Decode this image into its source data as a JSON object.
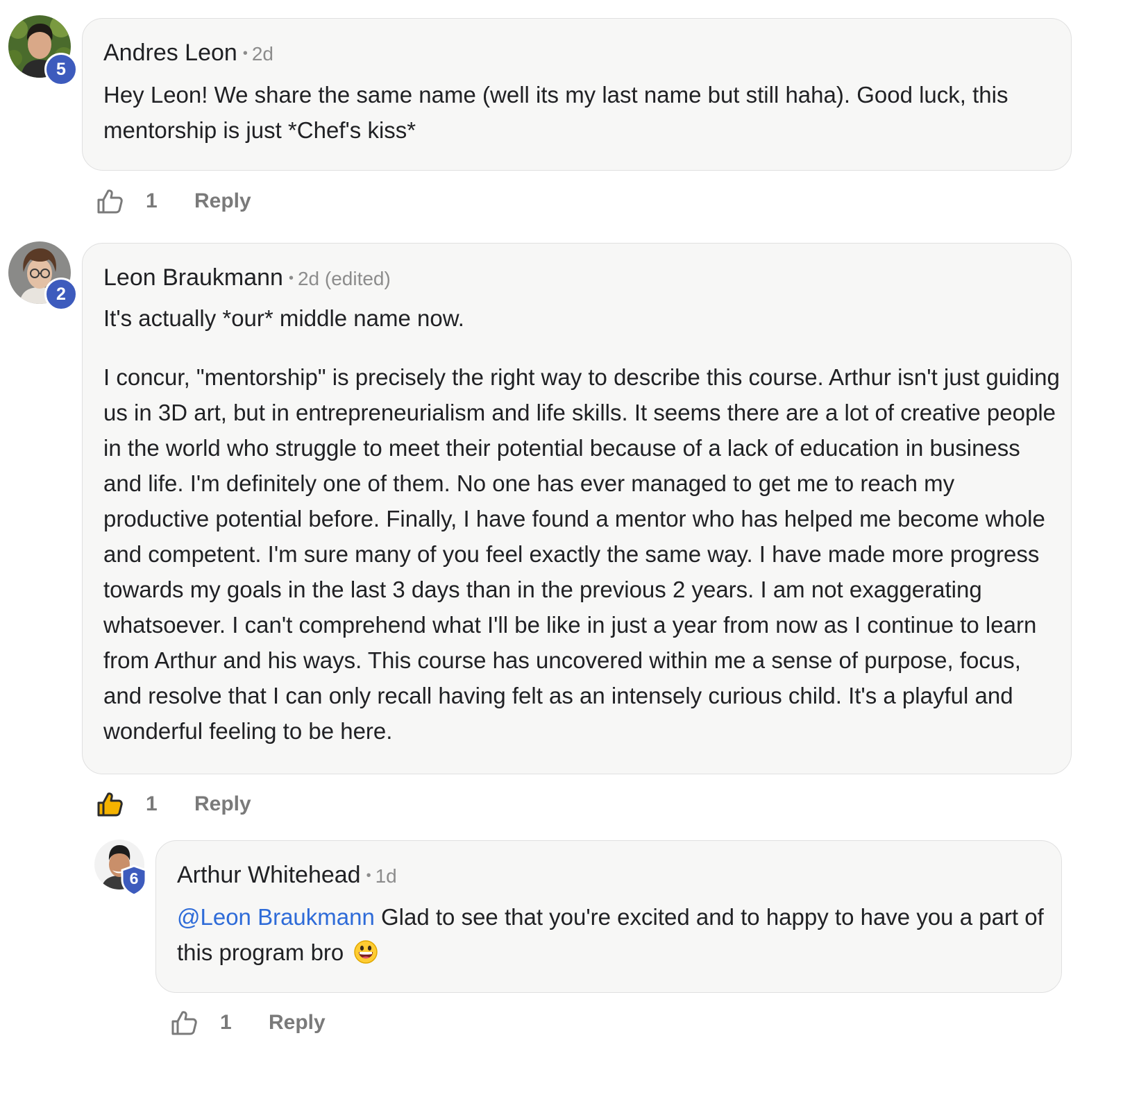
{
  "colors": {
    "badge": "#3d5bbd",
    "bubble_bg": "#f7f7f6",
    "mention": "#2e6bd8",
    "like_active": "#f5b300"
  },
  "comments": [
    {
      "author": "Andres Leon",
      "meta": "2d",
      "level": "5",
      "paragraphs": [
        "Hey Leon! We share the same name (well its my last name but still haha). Good luck, this mentorship is just *Chef's kiss*"
      ],
      "likes": "1",
      "liked": false,
      "reply_label": "Reply",
      "like_icon": "thumbs-up-icon"
    },
    {
      "author": "Leon Braukmann",
      "meta": "2d (edited)",
      "level": "2",
      "paragraphs": [
        "It's actually *our* middle name now.",
        "I concur, \"mentorship\" is precisely the right way to describe this course. Arthur isn't just guiding us in 3D art, but in entrepreneurialism and life skills. It seems there are a lot of creative people in the world who struggle to meet their potential because of a lack of education in business and life. I'm definitely one of them. No one has ever managed to get me to reach my productive potential before. Finally, I have found a mentor who has helped me become whole and competent. I'm sure many of you feel exactly the same way. I have made more progress towards my goals in the last 3 days than in the previous 2 years. I am not exaggerating whatsoever. I can't comprehend what I'll be like in just a year from now as I continue to learn from Arthur and his ways. This course has uncovered within me a sense of purpose, focus, and resolve that I can only recall having felt as an intensely curious child. It's a playful and wonderful feeling to be here."
      ],
      "likes": "1",
      "liked": true,
      "reply_label": "Reply",
      "like_icon": "thumbs-up-filled-icon"
    },
    {
      "author": "Arthur Whitehead",
      "meta": "1d",
      "level": "6",
      "mention": "@Leon Braukmann",
      "text": "Glad to see that you're excited and to happy to have you a part of this program bro",
      "emoji": "grinning-face-emoji",
      "likes": "1",
      "liked": false,
      "reply_label": "Reply",
      "like_icon": "thumbs-up-icon"
    }
  ]
}
